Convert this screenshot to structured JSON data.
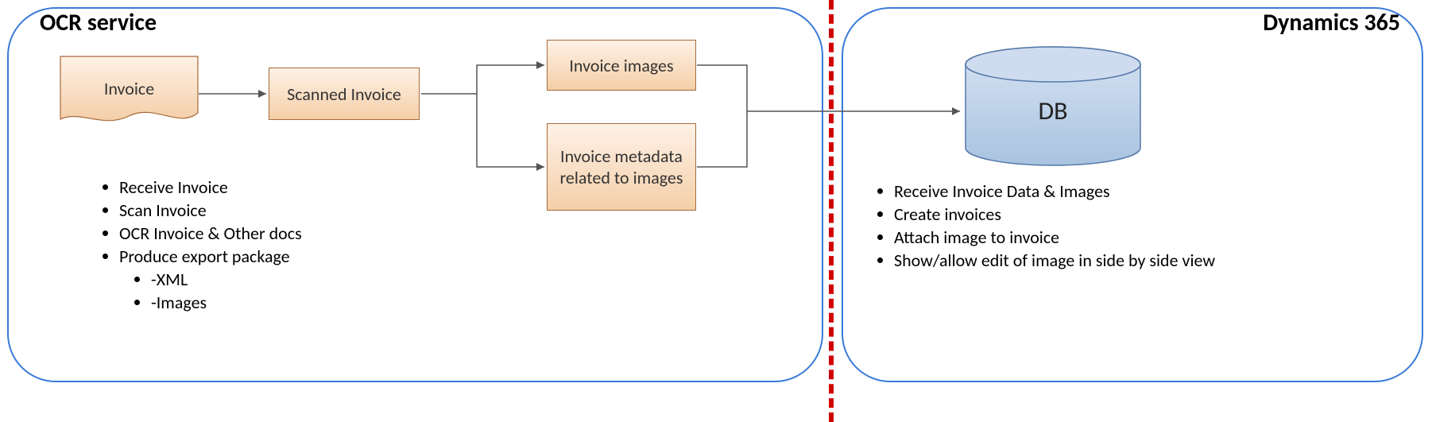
{
  "left_section_title": "OCR service",
  "right_section_title": "Dynamics 365",
  "invoice_label": "Invoice",
  "scanned_invoice_label": "Scanned Invoice",
  "invoice_images_label": "Invoice images",
  "invoice_metadata_label": "Invoice metadata related to images",
  "db_label": "DB",
  "left_bullets": {
    "b0": "Receive Invoice",
    "b1": "Scan Invoice",
    "b2": "OCR Invoice & Other docs",
    "b3": "Produce export package",
    "s0": "XML",
    "s1": "Images"
  },
  "right_bullets": {
    "b0": "Receive Invoice Data & Images",
    "b1": "Create invoices",
    "b2": "Attach image to invoice",
    "b3": "Show/allow edit of image in side by side view"
  },
  "colors": {
    "container_stroke": "#3a7ad9",
    "box_fill_top": "#fef1e6",
    "box_fill_bottom": "#f4cfa8",
    "db_fill": "#b9cee6",
    "divider": "#d00000",
    "arrow": "#555555"
  }
}
